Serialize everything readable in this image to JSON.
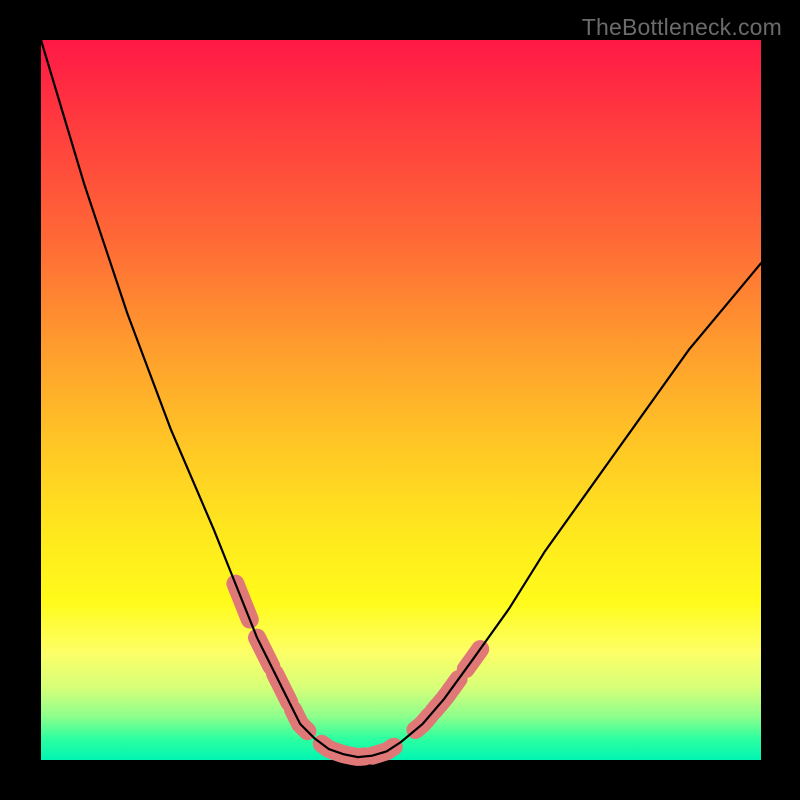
{
  "watermark": "TheBottleneck.com",
  "chart_data": {
    "type": "line",
    "title": "",
    "xlabel": "",
    "ylabel": "",
    "xlim": [
      0,
      100
    ],
    "ylim": [
      0,
      100
    ],
    "background_gradient": {
      "top": "#ff1846",
      "mid": "#ffe71e",
      "bottom": "#00f5b2"
    },
    "series": [
      {
        "name": "curve",
        "x": [
          0,
          3,
          6,
          9,
          12,
          15,
          18,
          21,
          24,
          26,
          28,
          30,
          32,
          34,
          36,
          38,
          40,
          42,
          44,
          46,
          48,
          50,
          53,
          56,
          60,
          65,
          70,
          75,
          80,
          85,
          90,
          95,
          100
        ],
        "values": [
          100,
          90,
          80,
          71,
          62,
          54,
          46,
          39,
          32,
          27,
          22,
          17,
          13,
          9,
          5,
          3,
          1.5,
          0.8,
          0.4,
          0.6,
          1.2,
          2.5,
          5,
          8.5,
          14,
          21,
          29,
          36,
          43,
          50,
          57,
          63,
          69
        ]
      }
    ],
    "highlighted_segments": [
      {
        "x_start": 27,
        "x_end": 29
      },
      {
        "x_start": 30,
        "x_end": 32
      },
      {
        "x_start": 32.5,
        "x_end": 34.5
      },
      {
        "x_start": 35,
        "x_end": 37
      },
      {
        "x_start": 39,
        "x_end": 45
      },
      {
        "x_start": 46,
        "x_end": 49
      },
      {
        "x_start": 52,
        "x_end": 54
      },
      {
        "x_start": 54.5,
        "x_end": 58
      },
      {
        "x_start": 59,
        "x_end": 61
      }
    ]
  }
}
